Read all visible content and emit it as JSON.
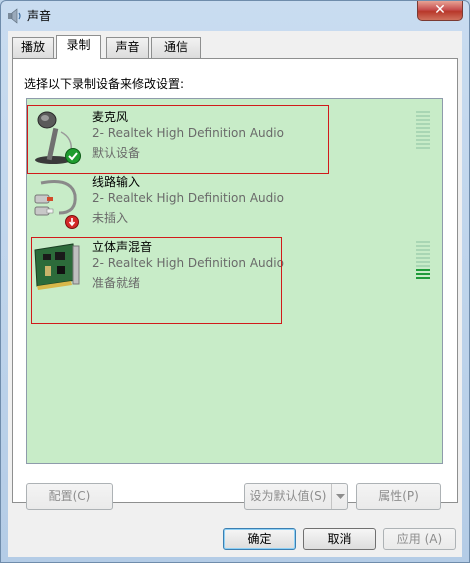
{
  "window": {
    "title": "声音",
    "close_glyph": "✕"
  },
  "tabs": [
    {
      "label": "播放",
      "active": false
    },
    {
      "label": "录制",
      "active": true
    },
    {
      "label": "声音",
      "active": false
    },
    {
      "label": "通信",
      "active": false
    }
  ],
  "instruction": "选择以下录制设备来修改设置:",
  "devices": [
    {
      "name": "麦克风",
      "description": "2- Realtek High Definition Audio",
      "status": "默认设备",
      "icon": "microphone-icon",
      "badge": "default-check-icon",
      "level": 0
    },
    {
      "name": "线路输入",
      "description": "2- Realtek High Definition Audio",
      "status": "未插入",
      "icon": "line-in-cable-icon",
      "badge": "unplugged-icon"
    },
    {
      "name": "立体声混音",
      "description": "2- Realtek High Definition Audio",
      "status": "准备就绪",
      "icon": "sound-card-icon",
      "level": 0.3
    }
  ],
  "buttons": {
    "configure": "配置(C)",
    "set_default": "设为默认值(S)",
    "properties": "属性(P)",
    "ok": "确定",
    "cancel": "取消",
    "apply": "应用 (A)"
  },
  "colors": {
    "list_background": "#c8ecc8",
    "highlight": "#d11a1a",
    "meter_on": "#1e9b39"
  }
}
